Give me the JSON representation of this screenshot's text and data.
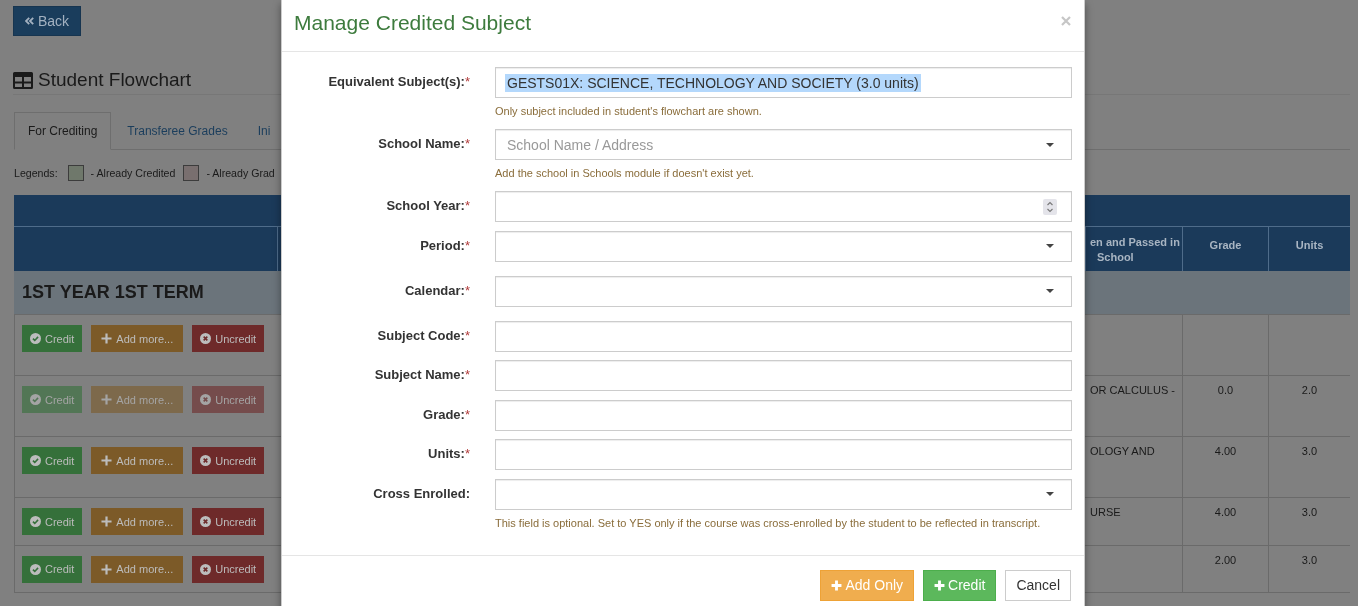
{
  "page": {
    "back_button": {
      "label": "Back"
    },
    "heading": "Student Flowchart",
    "tabs": [
      {
        "label": "For Crediting",
        "selected": true
      },
      {
        "label": "Transferee Grades",
        "selected": false
      },
      {
        "label": "Ini",
        "selected": false
      }
    ],
    "legend": {
      "label": "Legends:",
      "items": [
        {
          "label": "- Already Credited",
          "color": "#6f786b"
        },
        {
          "label": "- Already Grad",
          "color": "#796f6f"
        }
      ]
    },
    "table": {
      "columns": [
        {
          "lines": [
            "en and Passed in",
            "School"
          ]
        },
        {
          "lines": [
            "Grade"
          ]
        },
        {
          "lines": [
            "Units"
          ]
        }
      ],
      "term": "1ST YEAR 1ST TERM",
      "rows": [
        {
          "actions": [
            {
              "kind": "credit",
              "label": "Credit",
              "disabled": false
            },
            {
              "kind": "add",
              "label": "Add more...",
              "disabled": false
            },
            {
              "kind": "uncredit",
              "label": "Uncredit",
              "disabled": false
            }
          ]
        },
        {
          "actions": [
            {
              "kind": "credit",
              "label": "Credit",
              "disabled": true
            },
            {
              "kind": "add",
              "label": "Add more...",
              "disabled": true
            },
            {
              "kind": "uncredit",
              "label": "Uncredit",
              "disabled": true
            }
          ],
          "subject": "OR CALCULUS -",
          "grade": "0.0",
          "units": "2.0"
        },
        {
          "actions": [
            {
              "kind": "credit",
              "label": "Credit",
              "disabled": false
            },
            {
              "kind": "add",
              "label": "Add more...",
              "disabled": false
            },
            {
              "kind": "uncredit",
              "label": "Uncredit",
              "disabled": false
            }
          ],
          "subject": "OLOGY AND",
          "grade": "4.00",
          "units": "3.0"
        },
        {
          "actions": [
            {
              "kind": "credit",
              "label": "Credit",
              "disabled": false
            },
            {
              "kind": "add",
              "label": "Add more...",
              "disabled": false
            },
            {
              "kind": "uncredit",
              "label": "Uncredit",
              "disabled": false
            }
          ],
          "subject": "URSE",
          "grade": "4.00",
          "units": "3.0"
        },
        {
          "actions": [
            {
              "kind": "credit",
              "label": "Credit",
              "disabled": false
            },
            {
              "kind": "add",
              "label": "Add more...",
              "disabled": false
            },
            {
              "kind": "uncredit",
              "label": "Uncredit",
              "disabled": false
            }
          ],
          "grade": "2.00",
          "units": "3.0"
        }
      ]
    }
  },
  "modal": {
    "title": "Manage Credited Subject",
    "fields": [
      {
        "label": "Equivalent Subject(s):",
        "required_mark": "*",
        "kind": "text",
        "value": "GESTS01X: SCIENCE, TECHNOLOGY AND SOCIETY (3.0 units)",
        "value_selected": true,
        "help": "Only subject included in student's flowchart are shown."
      },
      {
        "label": "School Name:",
        "required_mark": "*",
        "kind": "select",
        "placeholder": "School Name / Address",
        "help": "Add the school in Schools module if doesn't exist yet."
      },
      {
        "label": "School Year:",
        "required_mark": "*",
        "kind": "number"
      },
      {
        "label": "Period:",
        "required_mark": "*",
        "kind": "select"
      },
      {
        "label": "Calendar:",
        "required_mark": "*",
        "kind": "select"
      },
      {
        "label": "Subject Code:",
        "required_mark": "*",
        "kind": "text"
      },
      {
        "label": "Subject Name:",
        "required_mark": "*",
        "kind": "text"
      },
      {
        "label": "Grade:",
        "required_mark": "*",
        "kind": "text"
      },
      {
        "label": "Units:",
        "required_mark": "*",
        "kind": "text"
      },
      {
        "label": "Cross Enrolled:",
        "kind": "select",
        "help": "This field is optional. Set to YES only if the course was cross-enrolled by the student to be reflected in transcript."
      }
    ],
    "buttons": [
      {
        "kind": "add",
        "label": "Add Only"
      },
      {
        "kind": "credit",
        "label": "Credit"
      },
      {
        "kind": "cancel",
        "label": "Cancel"
      }
    ]
  }
}
